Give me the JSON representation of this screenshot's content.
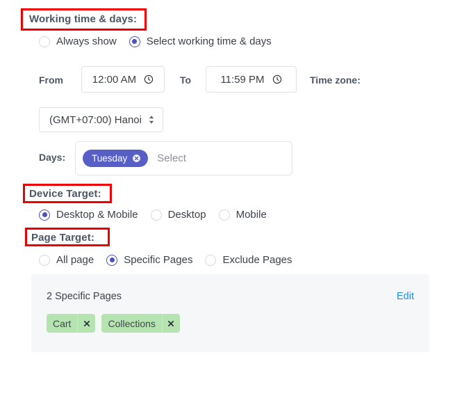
{
  "annotations": [
    {
      "target": "working-time-days-title"
    },
    {
      "target": "device-target-title"
    },
    {
      "target": "page-target-title"
    }
  ],
  "working_time": {
    "title": "Working time & days:",
    "mode_options": [
      {
        "label": "Always show",
        "selected": false
      },
      {
        "label": "Select working time & days",
        "selected": true
      }
    ],
    "from_label": "From",
    "from_value": "12:00 AM",
    "to_label": "To",
    "to_value": "11:59 PM",
    "timezone_label": "Time zone:",
    "timezone_value": "(GMT+07:00) Hanoi",
    "days_label": "Days:",
    "days_selected": [
      {
        "label": "Tuesday",
        "remove_icon": "circle-x-icon"
      }
    ],
    "days_placeholder": "Select",
    "clock_icon": "clock-icon",
    "select_spinner_icon": "spinner-arrows-icon"
  },
  "device_target": {
    "title": "Device Target:",
    "options": [
      {
        "label": "Desktop & Mobile",
        "selected": true
      },
      {
        "label": "Desktop",
        "selected": false
      },
      {
        "label": "Mobile",
        "selected": false
      }
    ]
  },
  "page_target": {
    "title": "Page Target:",
    "options": [
      {
        "label": "All page",
        "selected": false
      },
      {
        "label": "Specific Pages",
        "selected": true
      },
      {
        "label": "Exclude Pages",
        "selected": false
      }
    ],
    "panel": {
      "summary": "2 Specific Pages",
      "edit_label": "Edit",
      "tags": [
        {
          "label": "Cart",
          "remove_icon": "x-icon"
        },
        {
          "label": "Collections",
          "remove_icon": "x-icon"
        }
      ]
    }
  },
  "colors": {
    "accent_purple": "#4b51bf",
    "pill_purple": "#575fc7",
    "tag_green": "#b6e4b0",
    "link_blue": "#1f8cea",
    "annotation_red": "#ee0000",
    "panel_bg": "#f6f7f9",
    "label_slate": "#4c5766"
  }
}
